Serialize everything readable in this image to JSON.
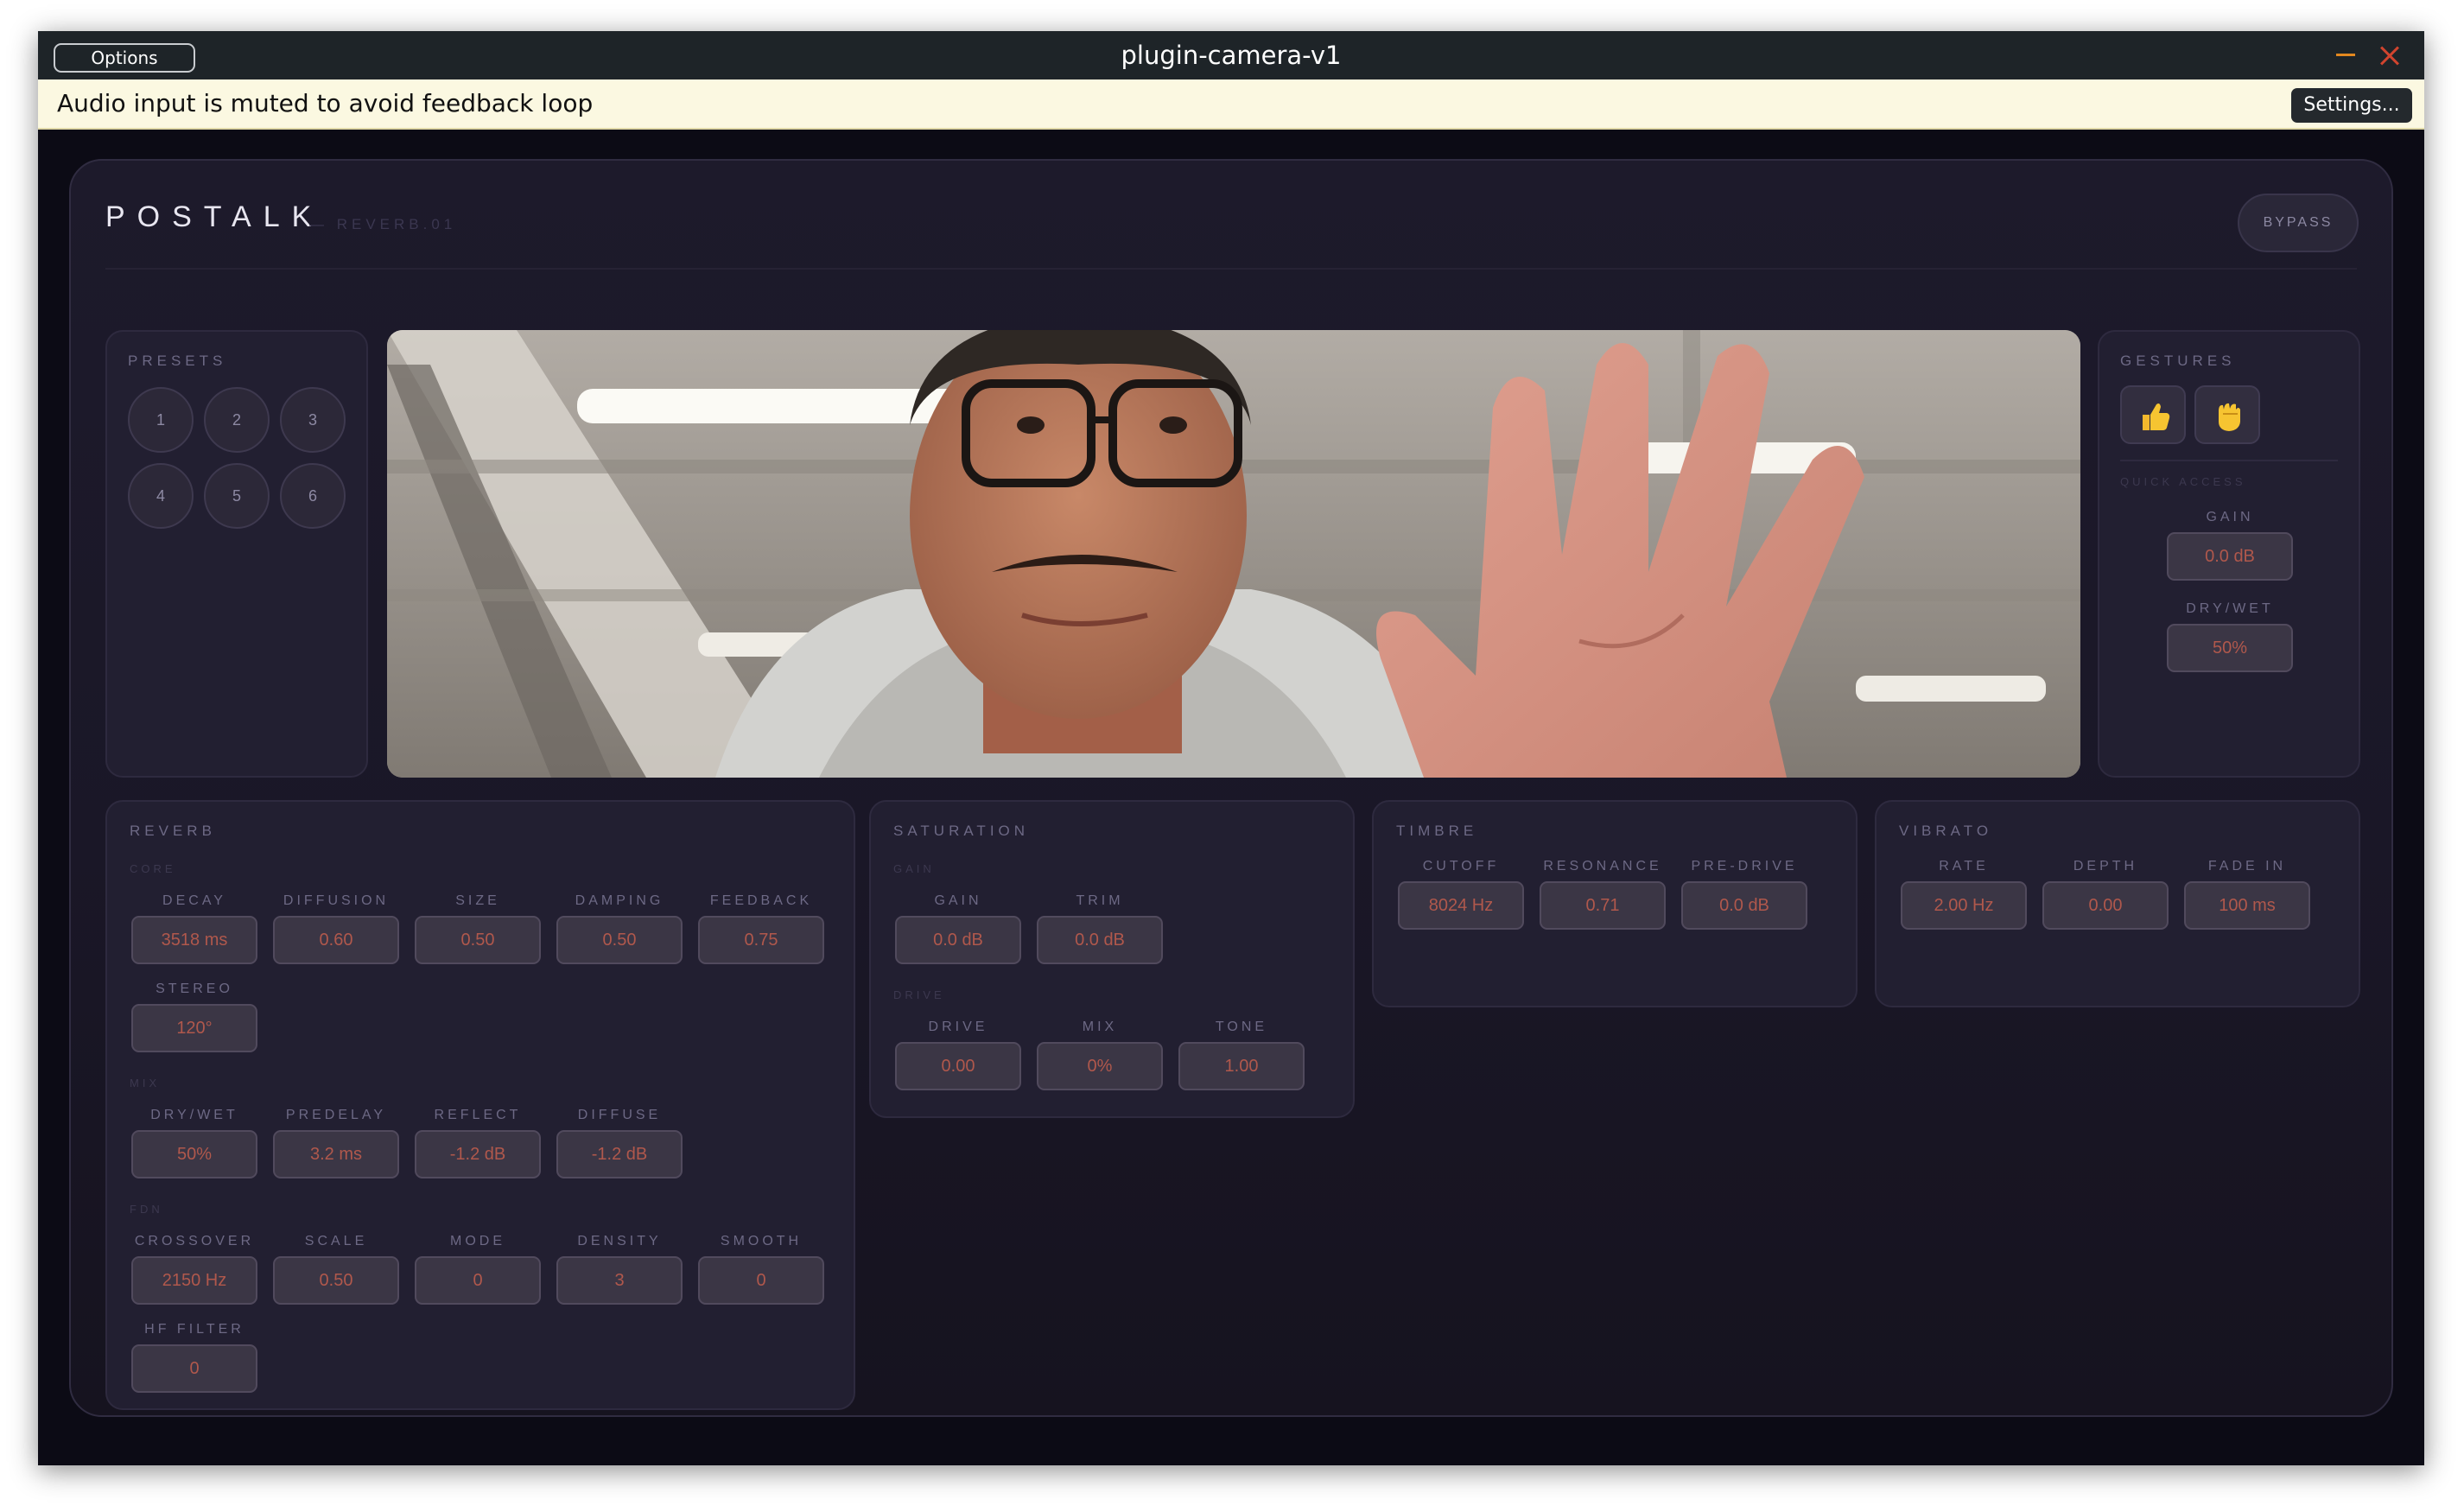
{
  "window": {
    "title": "plugin-camera-v1",
    "options_label": "Options",
    "notice": "Audio input is muted to avoid feedback loop",
    "settings_label": "Settings..."
  },
  "plugin": {
    "brand": "POSTALK",
    "subtitle": "— REVERB.01",
    "bypass_label": "BYPASS"
  },
  "presets": {
    "title": "PRESETS",
    "items": [
      "1",
      "2",
      "3",
      "4",
      "5",
      "6"
    ]
  },
  "gestures": {
    "title": "GESTURES",
    "icons": [
      "thumbs-up-icon",
      "raised-fist-icon"
    ],
    "quick_access": "QUICK ACCESS",
    "gain_label": "GAIN",
    "gain_value": "0.0 dB",
    "drywet_label": "DRY/WET",
    "drywet_value": "50%"
  },
  "reverb": {
    "title": "REVERB",
    "core_title": "CORE",
    "core": [
      {
        "label": "DECAY",
        "value": "3518 ms"
      },
      {
        "label": "DIFFUSION",
        "value": "0.60"
      },
      {
        "label": "SIZE",
        "value": "0.50"
      },
      {
        "label": "DAMPING",
        "value": "0.50"
      },
      {
        "label": "FEEDBACK",
        "value": "0.75"
      },
      {
        "label": "STEREO",
        "value": "120°"
      }
    ],
    "mix_title": "MIX",
    "mix": [
      {
        "label": "DRY/WET",
        "value": "50%"
      },
      {
        "label": "PREDELAY",
        "value": "3.2 ms"
      },
      {
        "label": "REFLECT",
        "value": "-1.2 dB"
      },
      {
        "label": "DIFFUSE",
        "value": "-1.2 dB"
      }
    ],
    "fdn_title": "FDN",
    "fdn": [
      {
        "label": "CROSSOVER",
        "value": "2150 Hz"
      },
      {
        "label": "SCALE",
        "value": "0.50"
      },
      {
        "label": "MODE",
        "value": "0"
      },
      {
        "label": "DENSITY",
        "value": "3"
      },
      {
        "label": "SMOOTH",
        "value": "0"
      },
      {
        "label": "HF FILTER",
        "value": "0"
      }
    ]
  },
  "saturation": {
    "title": "SATURATION",
    "gain_title": "GAIN",
    "gain": [
      {
        "label": "GAIN",
        "value": "0.0 dB"
      },
      {
        "label": "TRIM",
        "value": "0.0 dB"
      }
    ],
    "drive_title": "DRIVE",
    "drive": [
      {
        "label": "DRIVE",
        "value": "0.00"
      },
      {
        "label": "MIX",
        "value": "0%"
      },
      {
        "label": "TONE",
        "value": "1.00"
      }
    ]
  },
  "timbre": {
    "title": "TIMBRE",
    "controls": [
      {
        "label": "CUTOFF",
        "value": "8024 Hz"
      },
      {
        "label": "RESONANCE",
        "value": "0.71"
      },
      {
        "label": "PRE-DRIVE",
        "value": "0.0 dB"
      }
    ]
  },
  "vibrato": {
    "title": "VIBRATO",
    "controls": [
      {
        "label": "RATE",
        "value": "2.00 Hz"
      },
      {
        "label": "DEPTH",
        "value": "0.00"
      },
      {
        "label": "FADE IN",
        "value": "100 ms"
      }
    ]
  }
}
